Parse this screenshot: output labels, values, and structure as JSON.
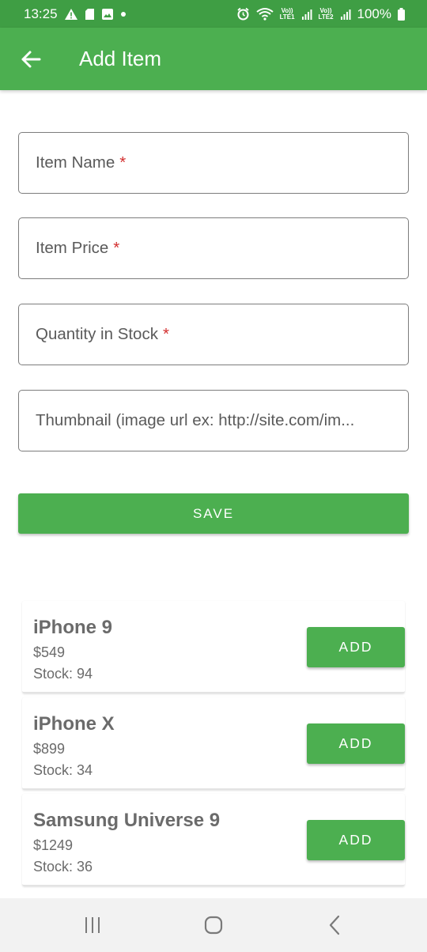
{
  "status_bar": {
    "time": "13:25",
    "left_icons": [
      "warning-icon",
      "sim-card-icon",
      "image-icon",
      "dot-icon"
    ],
    "right_icons": [
      "alarm-icon",
      "wifi-icon",
      "volte-lte1-icon",
      "signal-icon",
      "volte-lte2-icon",
      "signal-icon",
      "battery-icon"
    ],
    "volte1_top": "Vo))",
    "volte1_bottom": "LTE1",
    "volte2_top": "Vo))",
    "volte2_bottom": "LTE2",
    "battery": "100%"
  },
  "app_bar": {
    "back_icon": "arrow-left-icon",
    "title": "Add Item",
    "color": "#4caf50"
  },
  "form": {
    "item_name": {
      "placeholder": "Item Name",
      "required_mark": "*"
    },
    "item_price": {
      "placeholder": "Item Price",
      "required_mark": "*"
    },
    "quantity": {
      "placeholder": "Quantity in Stock",
      "required_mark": "*"
    },
    "thumbnail": {
      "placeholder": "Thumbnail (image url ex: http://site.com/im..."
    },
    "save_label": "SAVE"
  },
  "products": [
    {
      "name": "iPhone 9",
      "price": "$549",
      "stock": "Stock: 94",
      "button": "ADD"
    },
    {
      "name": "iPhone X",
      "price": "$899",
      "stock": "Stock: 34",
      "button": "ADD"
    },
    {
      "name": "Samsung Universe 9",
      "price": "$1249",
      "stock": "Stock: 36",
      "button": "ADD"
    }
  ],
  "nav_bar": {
    "icons": [
      "recent-apps-icon",
      "home-icon",
      "back-icon"
    ]
  }
}
